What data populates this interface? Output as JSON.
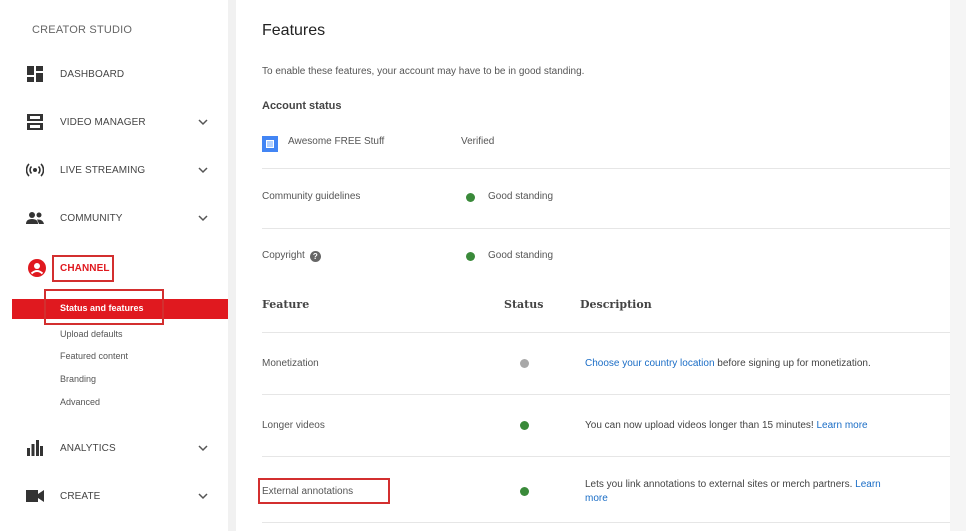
{
  "sidebar": {
    "title": "CREATOR STUDIO",
    "items": [
      {
        "label": "DASHBOARD",
        "icon": "dashboard-icon",
        "expandable": false
      },
      {
        "label": "VIDEO MANAGER",
        "icon": "video-manager-icon",
        "expandable": true
      },
      {
        "label": "LIVE STREAMING",
        "icon": "live-streaming-icon",
        "expandable": true
      },
      {
        "label": "COMMUNITY",
        "icon": "community-icon",
        "expandable": true
      },
      {
        "label": "CHANNEL",
        "icon": "channel-icon",
        "expandable": false
      },
      {
        "label": "ANALYTICS",
        "icon": "analytics-icon",
        "expandable": true
      },
      {
        "label": "CREATE",
        "icon": "create-icon",
        "expandable": true
      }
    ],
    "channel_sub": [
      {
        "label": "Status and features",
        "active": true
      },
      {
        "label": "Upload defaults",
        "active": false
      },
      {
        "label": "Featured content",
        "active": false
      },
      {
        "label": "Branding",
        "active": false
      },
      {
        "label": "Advanced",
        "active": false
      }
    ]
  },
  "main": {
    "title": "Features",
    "intro": "To enable these features, your account may have to be in good standing.",
    "account_status": {
      "heading": "Account status",
      "account_name": "Awesome FREE Stuff",
      "verified": "Verified"
    },
    "standing_rows": [
      {
        "label": "Community guidelines",
        "status": "Good standing",
        "help": false
      },
      {
        "label": "Copyright",
        "status": "Good standing",
        "help": true
      }
    ],
    "table": {
      "headers": {
        "feature": "Feature",
        "status": "Status",
        "description": "Description"
      },
      "rows": [
        {
          "feature": "Monetization",
          "status": "grey",
          "link": "Choose your country location",
          "text": " before signing up for monetization."
        },
        {
          "feature": "Longer videos",
          "status": "green",
          "text": "You can now upload videos longer than 15 minutes! ",
          "link_after": "Learn more"
        },
        {
          "feature": "External annotations",
          "status": "green",
          "text": "Lets you link annotations to external sites or merch partners. ",
          "link_after": "Learn",
          "line2_link": "more"
        }
      ]
    }
  },
  "colors": {
    "accent_red": "#e0191f",
    "highlight_box": "#d32f2f",
    "link": "#1a6dc6",
    "good": "#3a8a3a",
    "neutral": "#a8a8a8"
  }
}
